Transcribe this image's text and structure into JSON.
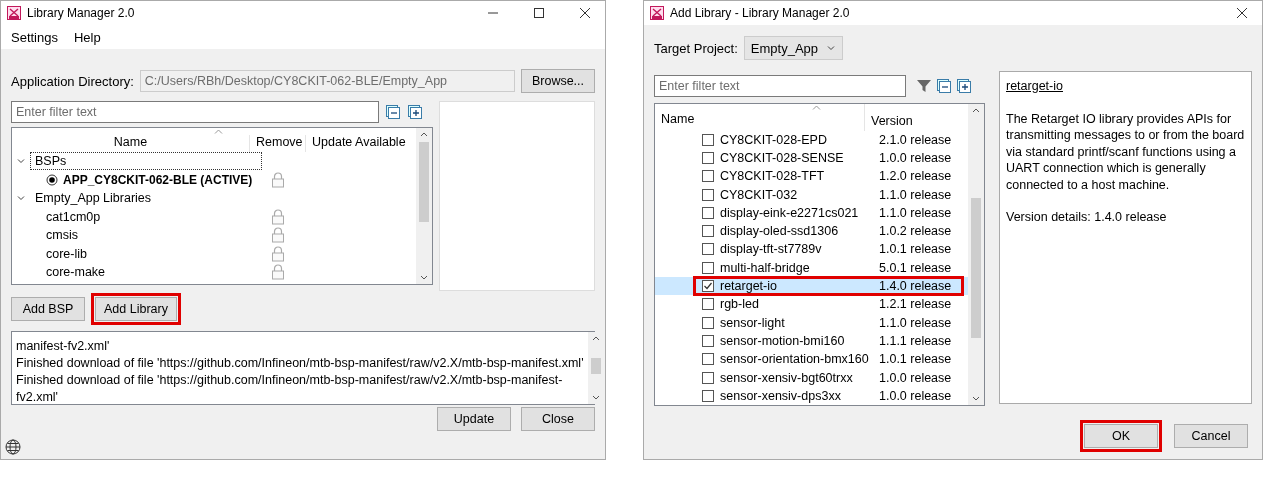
{
  "main_window": {
    "title": "Library Manager 2.0",
    "menu": [
      "Settings",
      "Help"
    ],
    "app_directory": {
      "label": "Application Directory:",
      "value": "C:/Users/RBh/Desktop/CY8CKIT-062-BLE/Empty_App",
      "disabled": true
    },
    "browse_button": "Browse...",
    "filter": {
      "placeholder": "Enter filter text"
    },
    "tree": {
      "columns": [
        "Name",
        "Remove",
        "Update Available"
      ],
      "groups": [
        {
          "label": "BSPs",
          "expanded": true,
          "focused": true,
          "children": [
            {
              "kind": "radio",
              "label": "APP_CY8CKIT-062-BLE (ACTIVE)",
              "selected": true,
              "locked": true
            }
          ]
        },
        {
          "label": "Empty_App Libraries",
          "expanded": true,
          "focused": false,
          "children": [
            {
              "kind": "plain",
              "label": "cat1cm0p",
              "locked": true
            },
            {
              "kind": "plain",
              "label": "cmsis",
              "locked": true
            },
            {
              "kind": "plain",
              "label": "core-lib",
              "locked": true
            },
            {
              "kind": "plain",
              "label": "core-make",
              "locked": true
            }
          ]
        }
      ]
    },
    "buttons": [
      {
        "label": "Add BSP",
        "highlighted": false
      },
      {
        "label": "Add Library",
        "highlighted": true
      }
    ],
    "log": [
      "manifest-fv2.xml'",
      "Finished download of file 'https://github.com/Infineon/mtb-bsp-manifest/raw/v2.X/mtb-bsp-manifest.xml'",
      "Finished download of file 'https://github.com/Infineon/mtb-bsp-manifest/raw/v2.X/mtb-bsp-manifest-",
      "fv2.xml'"
    ],
    "footer_buttons": [
      "Update",
      "Close"
    ]
  },
  "add_window": {
    "title": "Add Library - Library Manager 2.0",
    "target_project": {
      "label": "Target Project:",
      "value": "Empty_App"
    },
    "filter": {
      "placeholder": "Enter filter text"
    },
    "list": {
      "columns": [
        "Name",
        "Version"
      ],
      "items": [
        {
          "name": "CY8CKIT-028-EPD",
          "version": "2.1.0 release",
          "checked": false,
          "selected": false,
          "highlighted": false
        },
        {
          "name": "CY8CKIT-028-SENSE",
          "version": "1.0.0 release",
          "checked": false,
          "selected": false,
          "highlighted": false
        },
        {
          "name": "CY8CKIT-028-TFT",
          "version": "1.2.0 release",
          "checked": false,
          "selected": false,
          "highlighted": false
        },
        {
          "name": "CY8CKIT-032",
          "version": "1.1.0 release",
          "checked": false,
          "selected": false,
          "highlighted": false
        },
        {
          "name": "display-eink-e2271cs021",
          "version": "1.1.0 release",
          "checked": false,
          "selected": false,
          "highlighted": false
        },
        {
          "name": "display-oled-ssd1306",
          "version": "1.0.2 release",
          "checked": false,
          "selected": false,
          "highlighted": false
        },
        {
          "name": "display-tft-st7789v",
          "version": "1.0.1 release",
          "checked": false,
          "selected": false,
          "highlighted": false
        },
        {
          "name": "multi-half-bridge",
          "version": "5.0.1 release",
          "checked": false,
          "selected": false,
          "highlighted": false
        },
        {
          "name": "retarget-io",
          "version": "1.4.0 release",
          "checked": true,
          "selected": true,
          "highlighted": true
        },
        {
          "name": "rgb-led",
          "version": "1.2.1 release",
          "checked": false,
          "selected": false,
          "highlighted": false
        },
        {
          "name": "sensor-light",
          "version": "1.1.0 release",
          "checked": false,
          "selected": false,
          "highlighted": false
        },
        {
          "name": "sensor-motion-bmi160",
          "version": "1.1.1 release",
          "checked": false,
          "selected": false,
          "highlighted": false
        },
        {
          "name": "sensor-orientation-bmx160",
          "version": "1.0.1 release",
          "checked": false,
          "selected": false,
          "highlighted": false
        },
        {
          "name": "sensor-xensiv-bgt60trxx",
          "version": "1.0.0 release",
          "checked": false,
          "selected": false,
          "highlighted": false
        },
        {
          "name": "sensor-xensiv-dps3xx",
          "version": "1.0.0 release",
          "checked": false,
          "selected": false,
          "highlighted": false
        }
      ]
    },
    "details": {
      "name": "retarget-io",
      "description": "The Retarget IO library provides APIs for transmitting messages to or from the board via standard printf/scanf functions using a UART connection which is generally connected to a host machine.",
      "version": "Version details: 1.4.0 release"
    },
    "buttons": [
      {
        "label": "OK",
        "highlighted": true
      },
      {
        "label": "Cancel",
        "highlighted": false
      }
    ]
  }
}
